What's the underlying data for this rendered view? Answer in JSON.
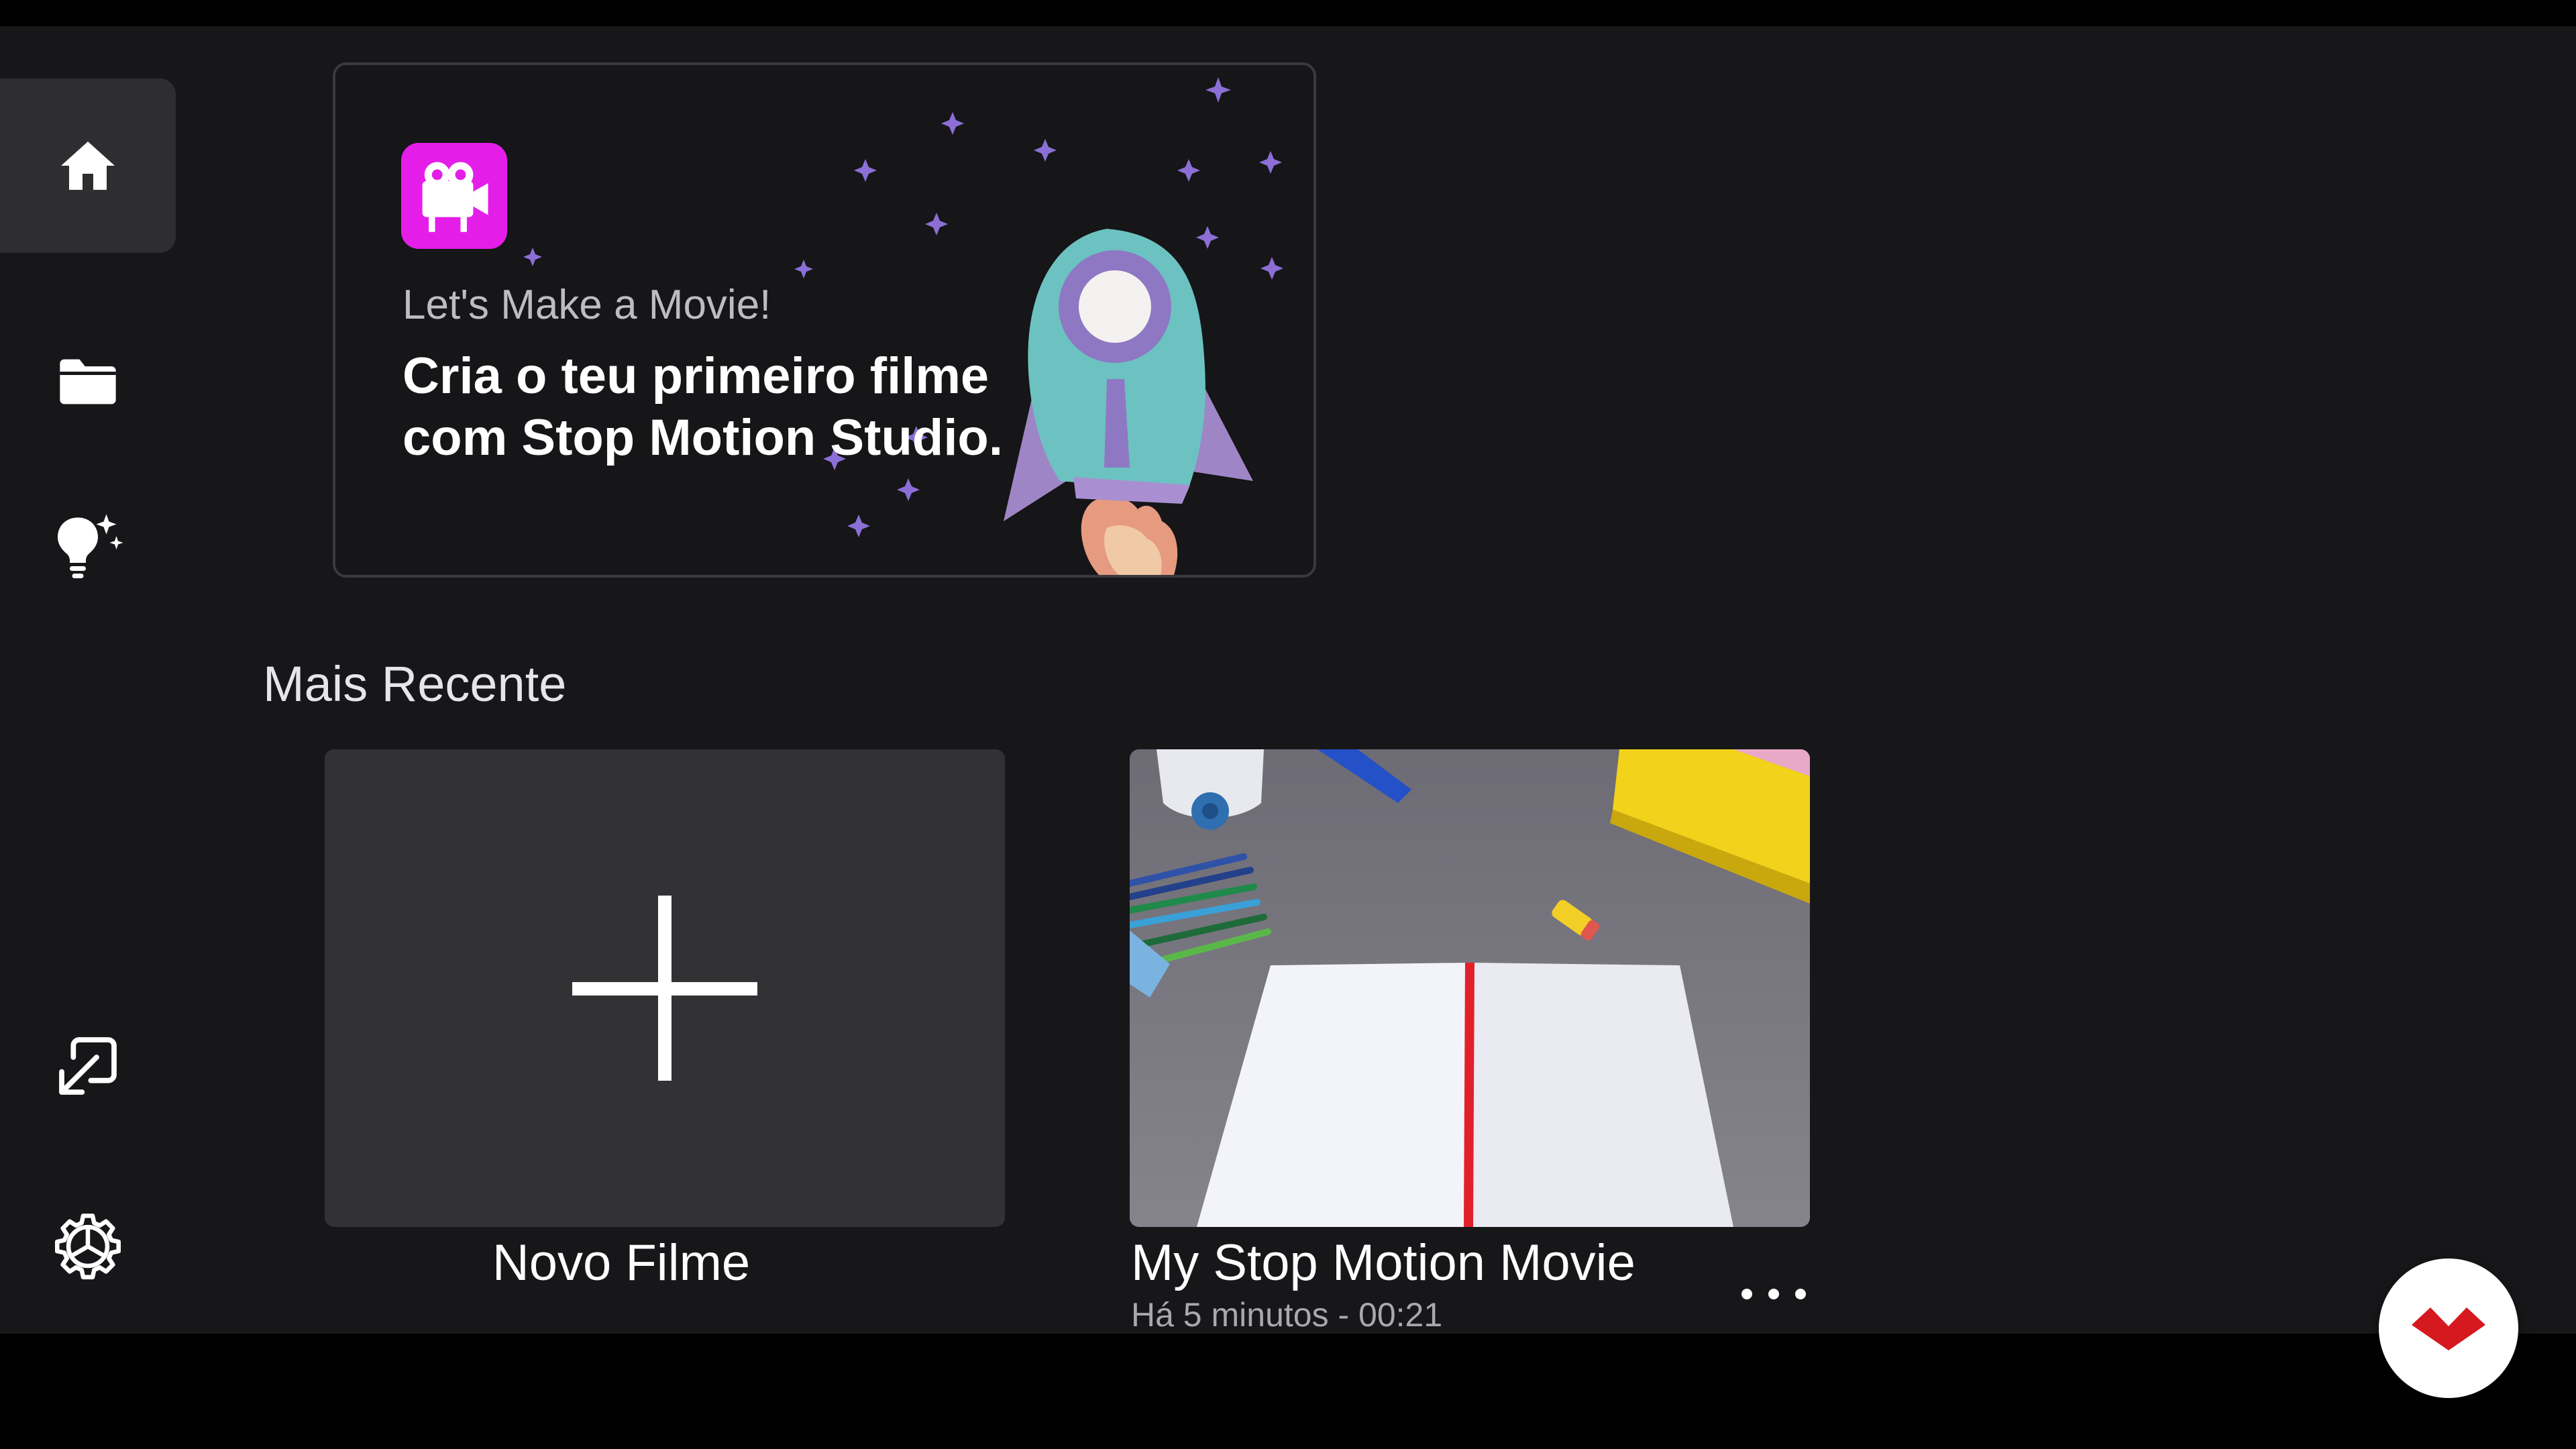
{
  "sidebar": {
    "items": [
      {
        "name": "home",
        "icon": "home-icon",
        "active": true
      },
      {
        "name": "projects",
        "icon": "folder-icon",
        "active": false
      },
      {
        "name": "ideas",
        "icon": "lightbulb-sparkle-icon",
        "active": false
      },
      {
        "name": "import",
        "icon": "import-icon",
        "active": false
      },
      {
        "name": "settings",
        "icon": "gear-icon",
        "active": false
      }
    ]
  },
  "banner": {
    "kicker": "Let's Make a Movie!",
    "headline_line1": "Cria o teu primeiro filme",
    "headline_line2": "com Stop Motion Studio.",
    "logo_icon": "movie-camera-icon"
  },
  "recent": {
    "title": "Mais Recente",
    "new_movie_label": "Novo Filme",
    "movies": [
      {
        "title": "My Stop Motion Movie",
        "meta": "Há 5 minutos - 00:21"
      }
    ]
  },
  "fab": {
    "icon": "brand-logo-icon"
  },
  "colors": {
    "app_background": "#171618",
    "card_background": "#323133",
    "logo_magenta": "#e41ee8",
    "accent_red": "#d6181f"
  }
}
